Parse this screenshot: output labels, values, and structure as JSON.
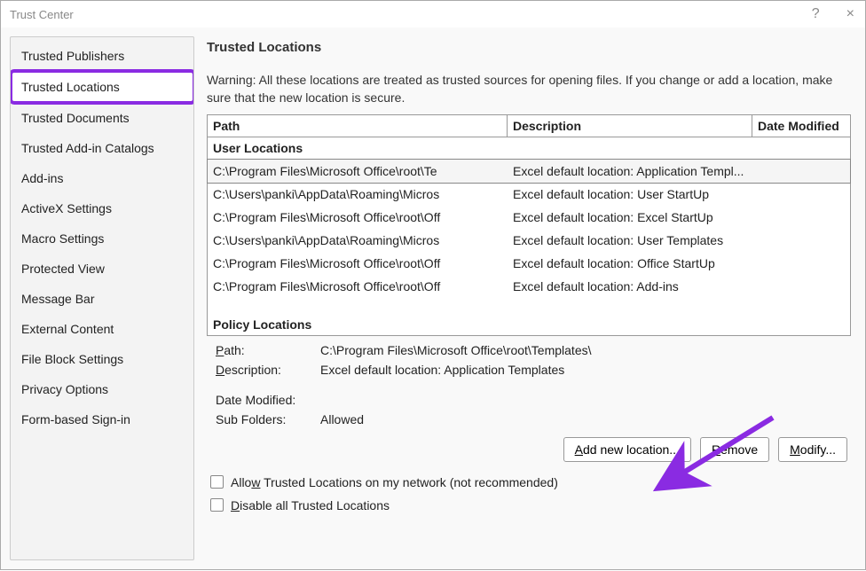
{
  "window": {
    "title": "Trust Center",
    "help": "?",
    "close": "×"
  },
  "sidebar": {
    "items": [
      "Trusted Publishers",
      "Trusted Locations",
      "Trusted Documents",
      "Trusted Add-in Catalogs",
      "Add-ins",
      "ActiveX Settings",
      "Macro Settings",
      "Protected View",
      "Message Bar",
      "External Content",
      "File Block Settings",
      "Privacy Options",
      "Form-based Sign-in"
    ],
    "selected_index": 1
  },
  "main": {
    "heading": "Trusted Locations",
    "warning": "Warning: All these locations are treated as trusted sources for opening files.  If you change or add a location, make sure that the new location is secure.",
    "columns": {
      "path": "Path",
      "desc": "Description",
      "date": "Date Modified"
    },
    "user_section": "User Locations",
    "policy_section": "Policy Locations",
    "rows": [
      {
        "path": "C:\\Program Files\\Microsoft Office\\root\\Te",
        "desc": "Excel default location: Application Templ...",
        "selected": true
      },
      {
        "path": "C:\\Users\\panki\\AppData\\Roaming\\Micros",
        "desc": "Excel default location: User StartUp"
      },
      {
        "path": "C:\\Program Files\\Microsoft Office\\root\\Off",
        "desc": "Excel default location: Excel StartUp"
      },
      {
        "path": "C:\\Users\\panki\\AppData\\Roaming\\Micros",
        "desc": "Excel default location: User Templates"
      },
      {
        "path": "C:\\Program Files\\Microsoft Office\\root\\Off",
        "desc": "Excel default location: Office StartUp"
      },
      {
        "path": "C:\\Program Files\\Microsoft Office\\root\\Off",
        "desc": "Excel default location: Add-ins"
      }
    ],
    "details": {
      "path_label": "Path:",
      "path_value": "C:\\Program Files\\Microsoft Office\\root\\Templates\\",
      "desc_label": "Description:",
      "desc_value": "Excel default location: Application Templates",
      "date_label": "Date Modified:",
      "date_value": "",
      "sub_label": "Sub Folders:",
      "sub_value": "Allowed"
    },
    "buttons": {
      "add": "Add new location...",
      "remove": "Remove",
      "modify": "Modify..."
    },
    "checkboxes": {
      "allow_network": "Allow Trusted Locations on my network (not recommended)",
      "disable_all": "Disable all Trusted Locations"
    }
  }
}
